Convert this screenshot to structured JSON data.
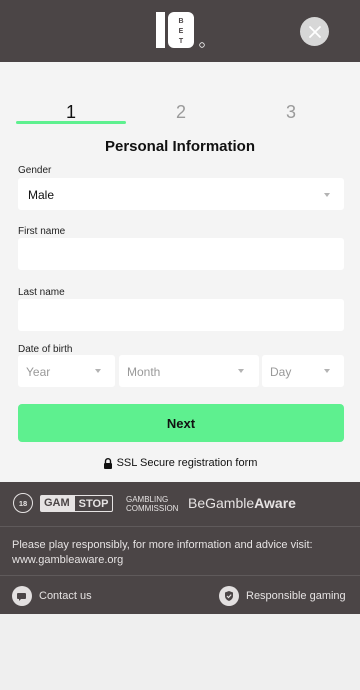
{
  "header": {
    "logo_text": "10BET",
    "close_icon": "close-icon"
  },
  "stepper": {
    "steps": [
      "1",
      "2",
      "3"
    ],
    "active_step": 1
  },
  "form": {
    "title": "Personal Information",
    "gender": {
      "label": "Gender",
      "value": "Male"
    },
    "first_name": {
      "label": "First name",
      "value": ""
    },
    "last_name": {
      "label": "Last name",
      "value": ""
    },
    "dob": {
      "label": "Date of birth",
      "year": "Year",
      "month": "Month",
      "day": "Day"
    },
    "next_label": "Next"
  },
  "ssl": {
    "text": "SSL Secure registration form",
    "icon": "lock-icon"
  },
  "footer": {
    "age_badge": "18",
    "gamstop_a": "GAM",
    "gamstop_b": "STOP",
    "gambling_commission_1": "GAMBLING",
    "gambling_commission_2": "COMMISSION",
    "begambleaware_a": "Be",
    "begambleaware_b": "Gamble",
    "begambleaware_c": "Aware",
    "responsible_text": "Please play responsibly, for more information and advice visit: www.gambleaware.org",
    "contact_label": "Contact us",
    "responsible_label": "Responsible gaming"
  },
  "colors": {
    "header_bg": "#4b4546",
    "accent": "#5ef08f"
  }
}
